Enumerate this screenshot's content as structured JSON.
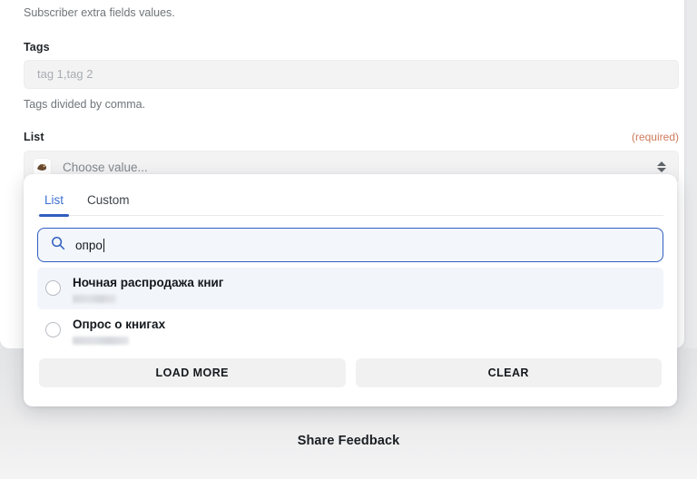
{
  "form": {
    "intro_helper": "Subscriber extra fields values.",
    "tags": {
      "label": "Tags",
      "value": "",
      "placeholder": "tag 1,tag 2",
      "helper": "Tags divided by comma."
    },
    "list": {
      "label": "List",
      "required_tag": "(required)",
      "select_placeholder": "Choose value...",
      "select_value": "",
      "favicon_name": "site-favicon"
    }
  },
  "dropdown": {
    "tabs": [
      {
        "label": "List",
        "active": true
      },
      {
        "label": "Custom",
        "active": false
      }
    ],
    "search": {
      "value": "опро",
      "placeholder": "",
      "icon": "search-icon"
    },
    "options": [
      {
        "title": "Ночная распродажа книг",
        "subtitle": "",
        "subtitle_redacted": true,
        "redacted_width": 48,
        "selected": false,
        "highlighted": true
      },
      {
        "title": "Опрос о книгах",
        "subtitle": "",
        "subtitle_redacted": true,
        "redacted_width": 62,
        "selected": false,
        "highlighted": false
      }
    ],
    "actions": {
      "load_more_label": "LOAD MORE",
      "clear_label": "CLEAR"
    }
  },
  "footer": {
    "share_feedback_label": "Share Feedback"
  },
  "colors": {
    "accent_blue": "#2f5fbe",
    "tab_active_text": "#3c6fd1",
    "required_orange": "#cf7b5c",
    "page_bg": "#e9eaec",
    "card_bg": "#ffffff",
    "input_bg": "#f3f3f4",
    "highlight_row": "#f2f5fa"
  }
}
